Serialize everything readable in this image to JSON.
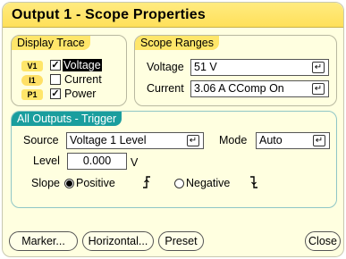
{
  "window": {
    "title": "Output 1 - Scope Properties"
  },
  "display_trace": {
    "header": "Display Trace",
    "items": [
      {
        "tag": "V1",
        "label": "Voltage",
        "checked": true,
        "selected": true
      },
      {
        "tag": "I1",
        "label": "Current",
        "checked": false,
        "selected": false
      },
      {
        "tag": "P1",
        "label": "Power",
        "checked": true,
        "selected": false
      }
    ]
  },
  "scope_ranges": {
    "header": "Scope Ranges",
    "voltage_label": "Voltage",
    "voltage_value": "51 V",
    "current_label": "Current",
    "current_value": "3.06 A CComp On"
  },
  "trigger": {
    "header": "All Outputs - Trigger",
    "source_label": "Source",
    "source_value": "Voltage 1 Level",
    "mode_label": "Mode",
    "mode_value": "Auto",
    "level_label": "Level",
    "level_value": "0.000",
    "level_unit": "V",
    "slope_label": "Slope",
    "slope_positive": "Positive",
    "slope_negative": "Negative",
    "slope_selected": "positive"
  },
  "icons": {
    "enter": "↵",
    "check": "✓",
    "rising_edge": "⨍",
    "falling_edge": "ʈ"
  },
  "buttons": {
    "marker": "Marker...",
    "horizontal": "Horizontal...",
    "preset": "Preset",
    "close": "Close"
  }
}
